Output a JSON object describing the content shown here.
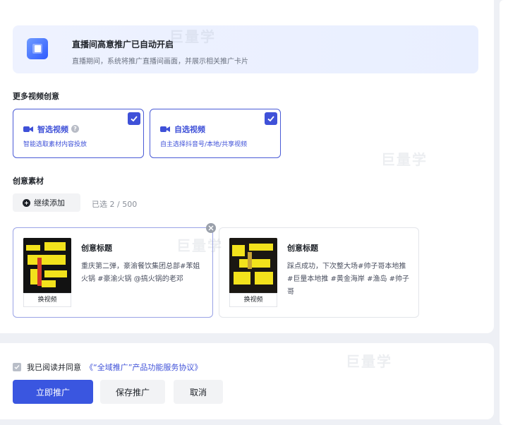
{
  "banner": {
    "title": "直播间高意推广已自动开启",
    "desc": "直播期间，系统将推广直播间画面，并展示相关推广卡片"
  },
  "more_creative": {
    "label": "更多视频创意",
    "options": [
      {
        "title": "智选视频",
        "desc": "智能选取素材内容投放",
        "checked": true,
        "has_help": true
      },
      {
        "title": "自选视频",
        "desc": "自主选择抖音号/本地/共享视频",
        "checked": true,
        "has_help": false
      }
    ]
  },
  "materials": {
    "label": "创意素材",
    "add_label": "继续添加",
    "selected_count": "已选 2 / 500",
    "items": [
      {
        "title": "创意标题",
        "text": "重庆第二弹，豪渝餐饮集团总部#苯姐火锅 #豪渝火锅 @搞火锅的老邓",
        "thumb_label": "换视频"
      },
      {
        "title": "创意标题",
        "text": "踩点成功，下次整大场#帅子哥本地推#巨量本地推 #黄金海岸 #渔岛 #帅子哥",
        "thumb_label": "换视频"
      }
    ]
  },
  "footer": {
    "agree_text": "我已阅读并同意",
    "agree_link": "《“全域推广”产品功能服务协议》",
    "primary_label": "立即推广",
    "save_label": "保存推广",
    "cancel_label": "取消"
  },
  "watermark": {
    "text": "巨量学"
  },
  "colors": {
    "accent": "#3f51d8",
    "primary_button": "#3a56e0",
    "banner_bg": "#eef2ff"
  }
}
